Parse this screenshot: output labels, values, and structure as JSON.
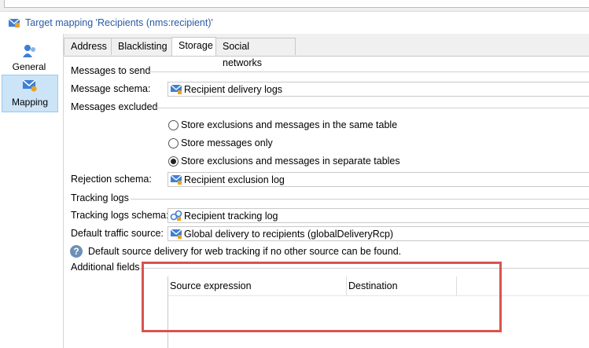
{
  "window": {
    "title": "Target mapping 'Recipients (nms:recipient)'"
  },
  "sidebar": {
    "items": [
      {
        "label": "General",
        "active": false
      },
      {
        "label": "Mapping",
        "active": true
      }
    ]
  },
  "tabs": [
    {
      "label": "Address",
      "active": false
    },
    {
      "label": "Blacklisting",
      "active": false
    },
    {
      "label": "Storage",
      "active": true
    },
    {
      "label": "Social networks",
      "active": false
    }
  ],
  "storage": {
    "messages_to_send": {
      "section": "Messages to send",
      "schema_label": "Message schema:",
      "schema_value": "Recipient delivery logs"
    },
    "messages_excluded": {
      "section": "Messages excluded",
      "options": [
        {
          "label": "Store exclusions and messages in the same table",
          "selected": false
        },
        {
          "label": "Store messages only",
          "selected": false
        },
        {
          "label": "Store exclusions and messages in separate tables",
          "selected": true
        }
      ],
      "rejection_label": "Rejection schema:",
      "rejection_value": "Recipient exclusion log"
    },
    "tracking_logs": {
      "section": "Tracking logs",
      "schema_label": "Tracking logs schema:",
      "schema_value": "Recipient tracking log",
      "traffic_label": "Default traffic source:",
      "traffic_value": "Global delivery to recipients (globalDeliveryRcp)",
      "info_text": "Default source delivery for web tracking if no other source can be found."
    },
    "additional_fields": {
      "section": "Additional fields",
      "columns": [
        "Source expression",
        "Destination"
      ]
    }
  },
  "colors": {
    "title_blue": "#2a5aa6",
    "highlight_red": "#d9534f",
    "selected_bg": "#cce4f7"
  }
}
